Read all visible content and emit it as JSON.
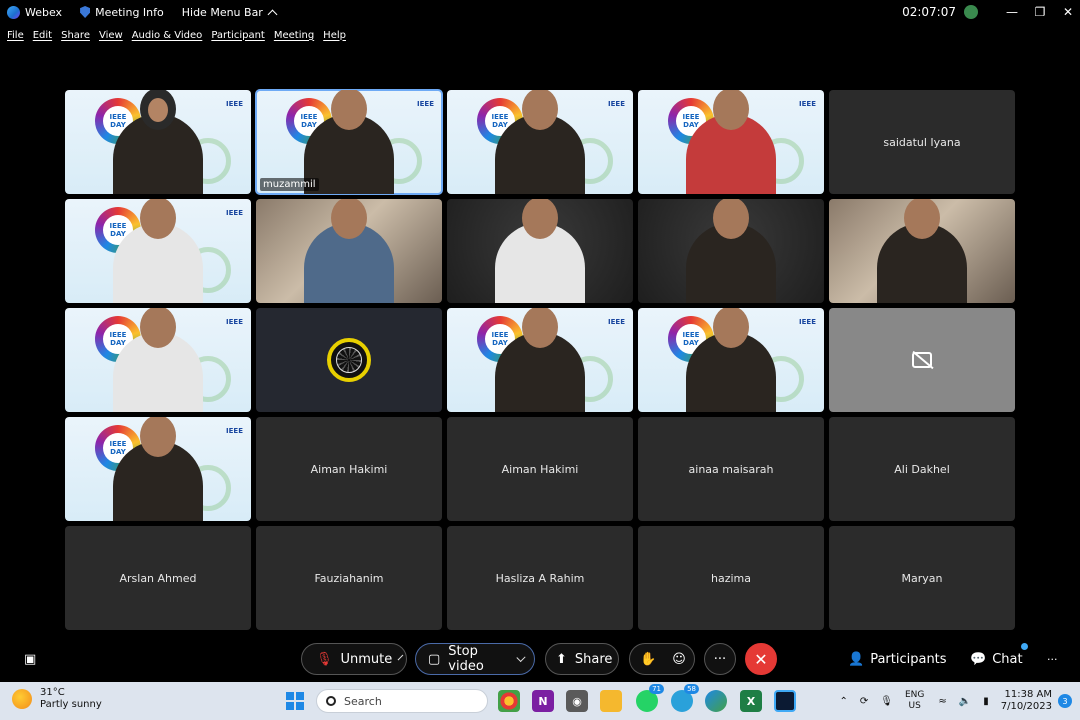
{
  "titlebar": {
    "app_name": "Webex",
    "meeting_info": "Meeting Info",
    "hide_menu_bar": "Hide Menu Bar",
    "timer": "02:07:07"
  },
  "menubar": {
    "items": [
      "File",
      "Edit",
      "Share",
      "View",
      "Audio & Video",
      "Participant",
      "Meeting",
      "Help"
    ]
  },
  "participants": {
    "active_speaker": "muzammil",
    "tiles": [
      {
        "type": "video",
        "name": ""
      },
      {
        "type": "video",
        "name": "muzammil"
      },
      {
        "type": "video",
        "name": ""
      },
      {
        "type": "video",
        "name": ""
      },
      {
        "type": "name",
        "name": "saidatul Iyana"
      },
      {
        "type": "video",
        "name": ""
      },
      {
        "type": "video",
        "name": ""
      },
      {
        "type": "video",
        "name": ""
      },
      {
        "type": "video",
        "name": ""
      },
      {
        "type": "video",
        "name": ""
      },
      {
        "type": "video",
        "name": ""
      },
      {
        "type": "avatar",
        "name": ""
      },
      {
        "type": "video",
        "name": ""
      },
      {
        "type": "video",
        "name": ""
      },
      {
        "type": "camera-off",
        "name": ""
      },
      {
        "type": "video",
        "name": ""
      },
      {
        "type": "name",
        "name": "Aiman Hakimi"
      },
      {
        "type": "name",
        "name": "Aiman Hakimi"
      },
      {
        "type": "name",
        "name": "ainaa maisarah"
      },
      {
        "type": "name",
        "name": "Ali Dakhel"
      },
      {
        "type": "name",
        "name": "Arslan Ahmed"
      },
      {
        "type": "name",
        "name": "Fauziahanim"
      },
      {
        "type": "name",
        "name": "Hasliza A Rahim"
      },
      {
        "type": "name",
        "name": "hazima"
      },
      {
        "type": "name",
        "name": "Maryan"
      }
    ],
    "ieee_badge_text": "IEEE DAY",
    "sponsor_text": "IEEE"
  },
  "controls": {
    "unmute": "Unmute",
    "stop_video": "Stop video",
    "share": "Share",
    "participants": "Participants",
    "chat": "Chat",
    "more": "···",
    "overflow": "···"
  },
  "taskbar": {
    "weather_temp": "31°C",
    "weather_desc": "Partly sunny",
    "search_placeholder": "Search",
    "whatsapp_badge": "71",
    "telegram_badge": "58",
    "lang_top": "ENG",
    "lang_bottom": "US",
    "time": "11:38 AM",
    "date": "7/10/2023",
    "notifications": "3"
  },
  "colors": {
    "accent": "#6eaaf5",
    "end_call": "#e53935",
    "taskbar": "#dde4ee"
  }
}
